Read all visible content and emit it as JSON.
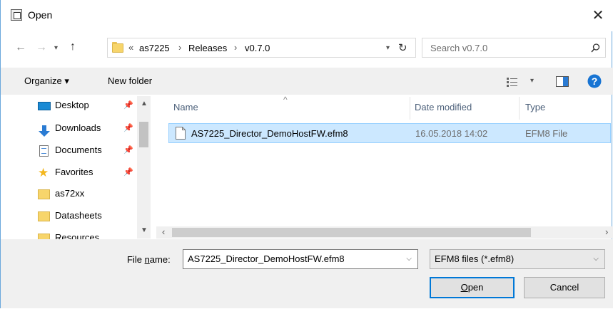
{
  "window": {
    "title": "Open"
  },
  "address": {
    "overflow": "«",
    "crumbs": [
      "as7225",
      "Releases",
      "v0.7.0"
    ],
    "separator": "›"
  },
  "search": {
    "placeholder": "Search v0.7.0"
  },
  "toolbar": {
    "organize_label": "Organize ▾",
    "new_folder_label": "New folder"
  },
  "nav": {
    "items": [
      {
        "label": "Desktop",
        "icon": "desktop-icon",
        "pinned": true
      },
      {
        "label": "Downloads",
        "icon": "download-arrow-icon",
        "pinned": true
      },
      {
        "label": "Documents",
        "icon": "document-icon",
        "pinned": true
      },
      {
        "label": "Favorites",
        "icon": "star-icon",
        "pinned": true
      },
      {
        "label": "as72xx",
        "icon": "folder-icon",
        "pinned": false
      },
      {
        "label": "Datasheets",
        "icon": "folder-icon",
        "pinned": false
      },
      {
        "label": "Resources",
        "icon": "folder-icon",
        "pinned": false
      }
    ]
  },
  "columns": {
    "name": "Name",
    "date": "Date modified",
    "type": "Type"
  },
  "files": [
    {
      "name": "AS7225_Director_DemoHostFW.efm8",
      "date": "16.05.2018 14:02",
      "type": "EFM8 File"
    }
  ],
  "bottom": {
    "file_name_label_pre": "File ",
    "file_name_label_u": "n",
    "file_name_label_post": "ame:",
    "file_name_value": "AS7225_Director_DemoHostFW.efm8",
    "filter_value": "EFM8 files (*.efm8)",
    "open_u": "O",
    "open_rest": "pen",
    "cancel_label": "Cancel"
  },
  "colors": {
    "selection": "#cce8ff",
    "selection_border": "#99d1ff",
    "accent": "#0078d7"
  }
}
